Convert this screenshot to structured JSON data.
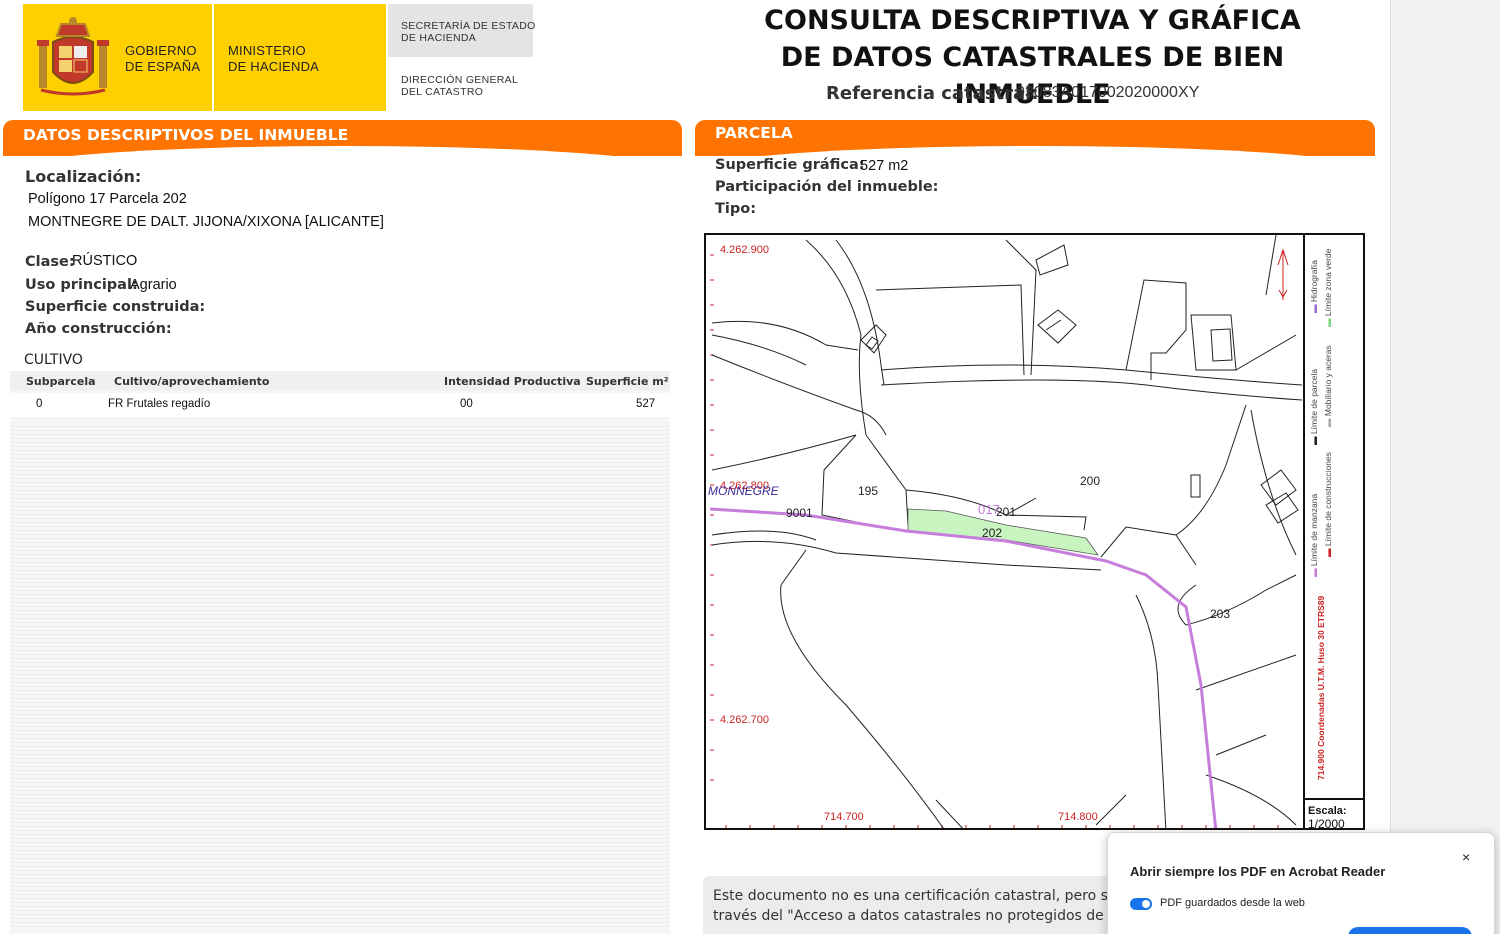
{
  "header": {
    "logo": {
      "gobierno": "GOBIERNO\nDE ESPAÑA",
      "ministerio": "MINISTERIO\nDE HACIENDA",
      "secretaria": "SECRETARÍA DE ESTADO\nDE HACIENDA",
      "direccion": "DIRECCIÓN GENERAL\nDEL CATASTRO"
    },
    "title_line1": "CONSULTA DESCRIPTIVA Y GRÁFICA",
    "title_line2": "DE DATOS CATASTRALES DE BIEN INMUEBLE",
    "ref_label": "Referencia catastral:",
    "ref_value": "03083A017002020000XY"
  },
  "descriptivos": {
    "section_title": "DATOS DESCRIPTIVOS DEL INMUEBLE",
    "localizacion_label": "Localización:",
    "localizacion_line1": "Polígono 17 Parcela 202",
    "localizacion_line2": "MONTNEGRE DE DALT. JIJONA/XIXONA [ALICANTE]",
    "clase_label": "Clase:",
    "clase_value": "RÚSTICO",
    "uso_label": "Uso principal:",
    "uso_value": "Agrario",
    "superficie_label": "Superficie construida:",
    "anio_label": "Año construcción:"
  },
  "cultivo": {
    "title": "CULTIVO",
    "headers": [
      "Subparcela",
      "Cultivo/aprovechamiento",
      "Intensidad Productiva",
      "Superficie m²"
    ],
    "rows": [
      {
        "subparcela": "0",
        "cultivo": "FR Frutales regadío",
        "intensidad": "00",
        "superficie": "527"
      }
    ]
  },
  "parcela": {
    "section_title": "PARCELA",
    "superficie_label": "Superficie gráfica:",
    "superficie_value": "527 m2",
    "participacion_label": "Participación del inmueble:",
    "tipo_label": "Tipo:"
  },
  "map": {
    "coords": {
      "y_top": "4.262.900",
      "y_mid": "4.262.800",
      "y_bottom": "4.262.700",
      "x_left": "714.700",
      "x_right": "714.800"
    },
    "parcel_labels": [
      "195",
      "200",
      "201",
      "202",
      "203",
      "9001"
    ],
    "poligono_label": "017",
    "place_label": "MONNEGRE",
    "legend": {
      "hidrografia": "Hidrografía",
      "zona_verde": "Límite zona verde",
      "parcela": "Límite de parcela",
      "mobiliario": "Mobiliario y aceras",
      "manzana": "Límite de manzana",
      "construcciones": "Límite de construcciones",
      "coordenadas": "714.900 Coordenadas U.T.M. Huso 30 ETRS89"
    },
    "scale_label": "Escala:",
    "scale_value": "1/2000",
    "colors": {
      "route": "#c77ddc",
      "parcel_fill": "#c8f4c0",
      "coord_text": "#cc2222"
    }
  },
  "info_text_line1": "Este documento no es una certificación catastral, pero sus",
  "info_text_line2": "través del \"Acceso a datos catastrales no protegidos de la S",
  "popup": {
    "title": "Abrir siempre los PDF en Acrobat Reader",
    "toggle_label": "PDF guardados desde la web",
    "close_glyph": "×"
  }
}
